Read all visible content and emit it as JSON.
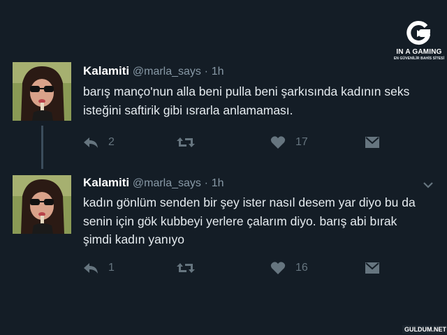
{
  "logo": {
    "name": "IN A GAMING",
    "subtitle": "EN GÜVENİLİR BAHİS SİTESİ"
  },
  "tweets": [
    {
      "author": "Kalamiti",
      "handle": "@marla_says",
      "separator": "·",
      "time": "1h",
      "text": "barış manço'nun alla beni pulla beni şarkısında kadının seks isteğini saftirik gibi ısrarla anlamaması.",
      "reply_count": "2",
      "like_count": "17"
    },
    {
      "author": "Kalamiti",
      "handle": "@marla_says",
      "separator": "·",
      "time": "1h",
      "text": "kadın gönlüm senden bir şey ister nasıl desem yar diyo bu da senin için gök kubbeyi yerlere çalarım diyo. barış abi bırak şimdi kadın yanıyo",
      "reply_count": "1",
      "like_count": "16"
    }
  ],
  "watermark": "GULDUM.NET",
  "colors": {
    "background": "#141d26",
    "muted": "#8899a6",
    "icon": "#66757f",
    "text": "#e6ecf0"
  }
}
